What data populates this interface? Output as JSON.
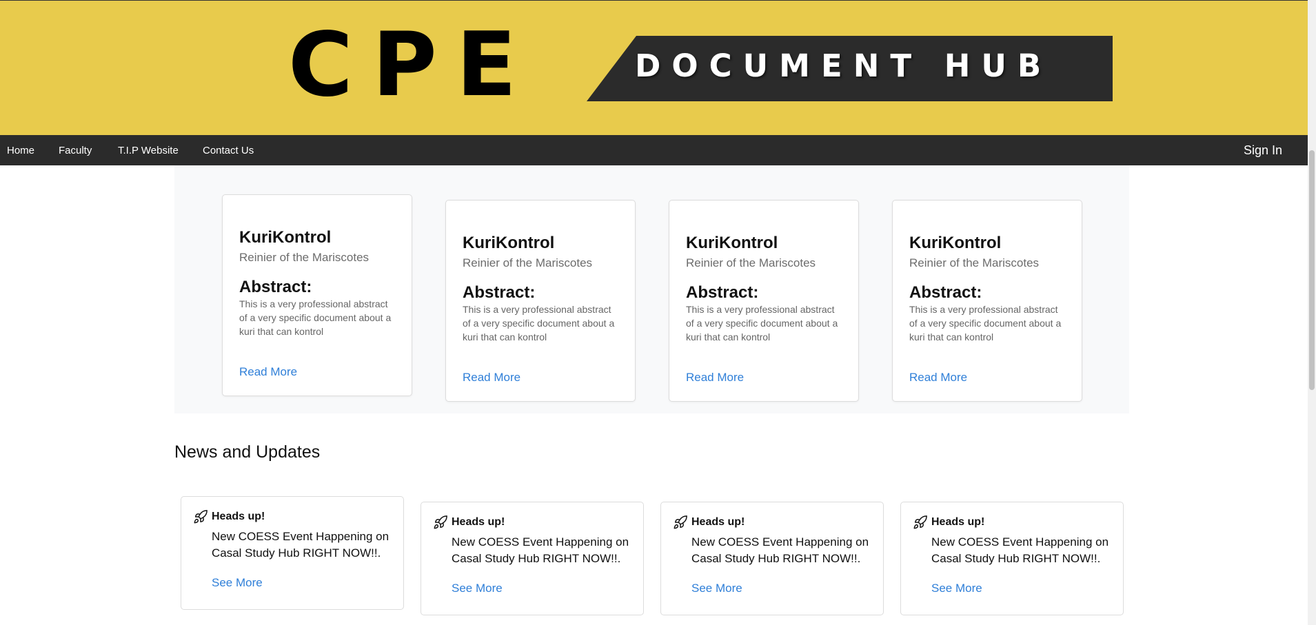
{
  "banner": {
    "logo": "CPE",
    "subtitle": "DOCUMENT HUB"
  },
  "nav": {
    "items": [
      {
        "label": "Home"
      },
      {
        "label": "Faculty"
      },
      {
        "label": "T.I.P Website"
      },
      {
        "label": "Contact Us"
      }
    ],
    "signin": "Sign In"
  },
  "documents": [
    {
      "title": "KuriKontrol",
      "author": "Reinier of the Mariscotes",
      "abstract_heading": "Abstract:",
      "abstract": "This is a very professional abstract of a very specific document about a kuri that can kontrol",
      "link": "Read More"
    },
    {
      "title": "KuriKontrol",
      "author": "Reinier of the Mariscotes",
      "abstract_heading": "Abstract:",
      "abstract": "This is a very professional abstract of a very specific document about a kuri that can kontrol",
      "link": "Read More"
    },
    {
      "title": "KuriKontrol",
      "author": "Reinier of the Mariscotes",
      "abstract_heading": "Abstract:",
      "abstract": "This is a very professional abstract of a very specific document about a kuri that can kontrol",
      "link": "Read More"
    },
    {
      "title": "KuriKontrol",
      "author": "Reinier of the Mariscotes",
      "abstract_heading": "Abstract:",
      "abstract": "This is a very professional abstract of a very specific document about a kuri that can kontrol",
      "link": "Read More"
    }
  ],
  "news": {
    "heading": "News and Updates",
    "icon": "rocket-icon",
    "items": [
      {
        "label": "Heads up!",
        "body": "New COESS Event Happening on Casal Study Hub RIGHT NOW!!.",
        "link": "See More"
      },
      {
        "label": "Heads up!",
        "body": "New COESS Event Happening on Casal Study Hub RIGHT NOW!!.",
        "link": "See More"
      },
      {
        "label": "Heads up!",
        "body": "New COESS Event Happening on Casal Study Hub RIGHT NOW!!.",
        "link": "See More"
      },
      {
        "label": "Heads up!",
        "body": "New COESS Event Happening on Casal Study Hub RIGHT NOW!!.",
        "link": "See More"
      }
    ]
  },
  "colors": {
    "banner": "#e8cb4c",
    "dark": "#2b2b2b",
    "link": "#2f7fd8"
  }
}
